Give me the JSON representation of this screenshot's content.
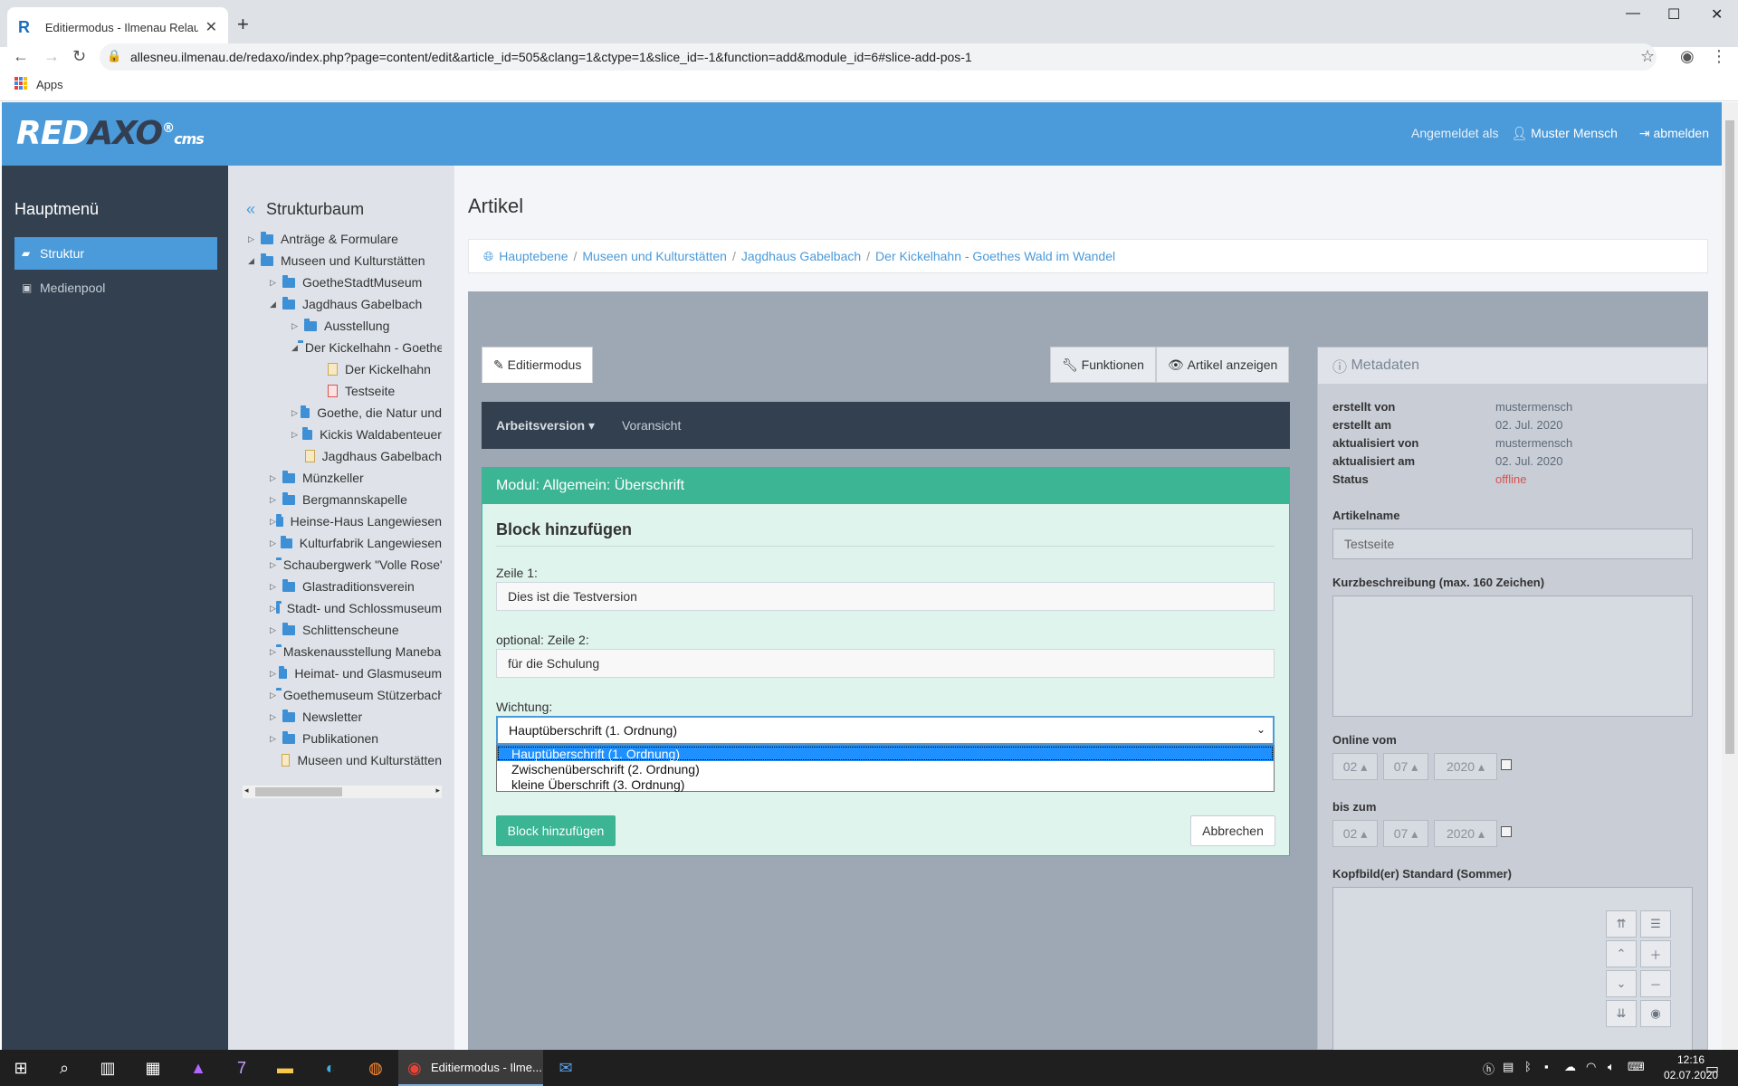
{
  "browser": {
    "tab_title": "Editiermodus - Ilmenau Relaunch",
    "tab_favicon": "R",
    "url": "allesneu.ilmenau.de/redaxo/index.php?page=content/edit&article_id=505&clang=1&ctype=1&slice_id=-1&function=add&module_id=6#slice-add-pos-1",
    "bookmark_apps": "Apps"
  },
  "header": {
    "logo_red": "RED",
    "logo_axo": "AXO",
    "logo_reg": "®",
    "logo_cms": "cms",
    "logged_in_as": "Angemeldet als",
    "user": "Muster Mensch",
    "logout": "abmelden",
    "color": "#4b9ad9"
  },
  "sidebar": {
    "title": "Hauptmenü",
    "items": [
      {
        "label": "Struktur",
        "icon": "folder-open-icon",
        "active": true
      },
      {
        "label": "Medienpool",
        "icon": "image-icon",
        "active": false
      }
    ]
  },
  "tree": {
    "title": "Strukturbaum",
    "nodes": [
      {
        "label": "Anträge & Formulare",
        "type": "folder",
        "toggle": "▷"
      },
      {
        "label": "Museen und Kulturstätten",
        "type": "folder",
        "toggle": "◢"
      },
      {
        "label": "GoetheStadtMuseum",
        "type": "folder",
        "toggle": "▷"
      },
      {
        "label": "Jagdhaus Gabelbach",
        "type": "folder",
        "toggle": "◢"
      },
      {
        "label": "Ausstellung",
        "type": "folder",
        "toggle": "▷"
      },
      {
        "label": "Der Kickelhahn - Goethes Wald im Wandel",
        "type": "folder",
        "toggle": "◢"
      },
      {
        "label": "Der Kickelhahn",
        "type": "doc",
        "toggle": ""
      },
      {
        "label": "Testseite",
        "type": "doc-red",
        "toggle": ""
      },
      {
        "label": "Goethe, die Natur und",
        "type": "folder",
        "toggle": "▷"
      },
      {
        "label": "Kickis Waldabenteuer",
        "type": "folder",
        "toggle": "▷"
      },
      {
        "label": "Jagdhaus Gabelbach",
        "type": "doc",
        "toggle": ""
      },
      {
        "label": "Münzkeller",
        "type": "folder",
        "toggle": "▷"
      },
      {
        "label": "Bergmannskapelle",
        "type": "folder",
        "toggle": "▷"
      },
      {
        "label": "Heinse-Haus Langewiesen",
        "type": "folder",
        "toggle": "▷"
      },
      {
        "label": "Kulturfabrik Langewiesen",
        "type": "folder",
        "toggle": "▷"
      },
      {
        "label": "Schaubergwerk \"Volle Rose\"",
        "type": "folder",
        "toggle": "▷"
      },
      {
        "label": "Glastraditionsverein",
        "type": "folder",
        "toggle": "▷"
      },
      {
        "label": "Stadt- und Schlossmuseum",
        "type": "folder",
        "toggle": "▷"
      },
      {
        "label": "Schlittenscheune",
        "type": "folder",
        "toggle": "▷"
      },
      {
        "label": "Maskenausstellung Manebach",
        "type": "folder",
        "toggle": "▷"
      },
      {
        "label": "Heimat- und Glasmuseum",
        "type": "folder",
        "toggle": "▷"
      },
      {
        "label": "Goethemuseum Stützerbach",
        "type": "folder",
        "toggle": "▷"
      },
      {
        "label": "Newsletter",
        "type": "folder",
        "toggle": "▷"
      },
      {
        "label": "Publikationen",
        "type": "folder",
        "toggle": "▷"
      },
      {
        "label": "Museen und Kulturstätten",
        "type": "doc",
        "toggle": ""
      }
    ]
  },
  "main": {
    "title": "Artikel",
    "breadcrumb": [
      "Hauptebene",
      "Museen und Kulturstätten",
      "Jagdhaus Gabelbach",
      "Der Kickelhahn - Goethes Wald im Wandel"
    ],
    "tabs": {
      "edit": "Editiermodus",
      "functions": "Funktionen",
      "show": "Artikel anzeigen"
    },
    "workbar": {
      "version": "Arbeitsversion",
      "preview": "Voransicht"
    },
    "module": {
      "header": "Modul: Allgemein: Überschrift",
      "block_title": "Block hinzufügen",
      "line1_label": "Zeile 1:",
      "line1_value": "Dies ist die Testversion",
      "line2_label": "optional: Zeile 2:",
      "line2_value": "für die Schulung",
      "weight_label": "Wichtung:",
      "weight_selected": "Hauptüberschrift (1. Ordnung)",
      "weight_options": [
        "Hauptüberschrift (1. Ordnung)",
        "Zwischenüberschrift (2. Ordnung)",
        "kleine Überschrift (3. Ordnung)"
      ],
      "add_button": "Block hinzufügen",
      "cancel_button": "Abbrechen",
      "color": "#3bb594"
    }
  },
  "meta": {
    "title": "Metadaten",
    "rows": [
      {
        "k": "erstellt von",
        "v": "mustermensch"
      },
      {
        "k": "erstellt am",
        "v": "02. Jul. 2020"
      },
      {
        "k": "aktualisiert von",
        "v": "mustermensch"
      },
      {
        "k": "aktualisiert am",
        "v": "02. Jul. 2020"
      },
      {
        "k": "Status",
        "v": "offline"
      }
    ],
    "article_name_label": "Artikelname",
    "article_name": "Testseite",
    "desc_label": "Kurzbeschreibung (max. 160 Zeichen)",
    "online_from_label": "Online vom",
    "online_to_label": "bis zum",
    "date": {
      "day": "02",
      "month": "07",
      "year": "2020"
    },
    "header_image_label": "Kopfbild(er) Standard (Sommer)"
  },
  "taskbar": {
    "active_window": "Editiermodus - Ilme...",
    "time": "12:16",
    "date": "02.07.2020"
  }
}
